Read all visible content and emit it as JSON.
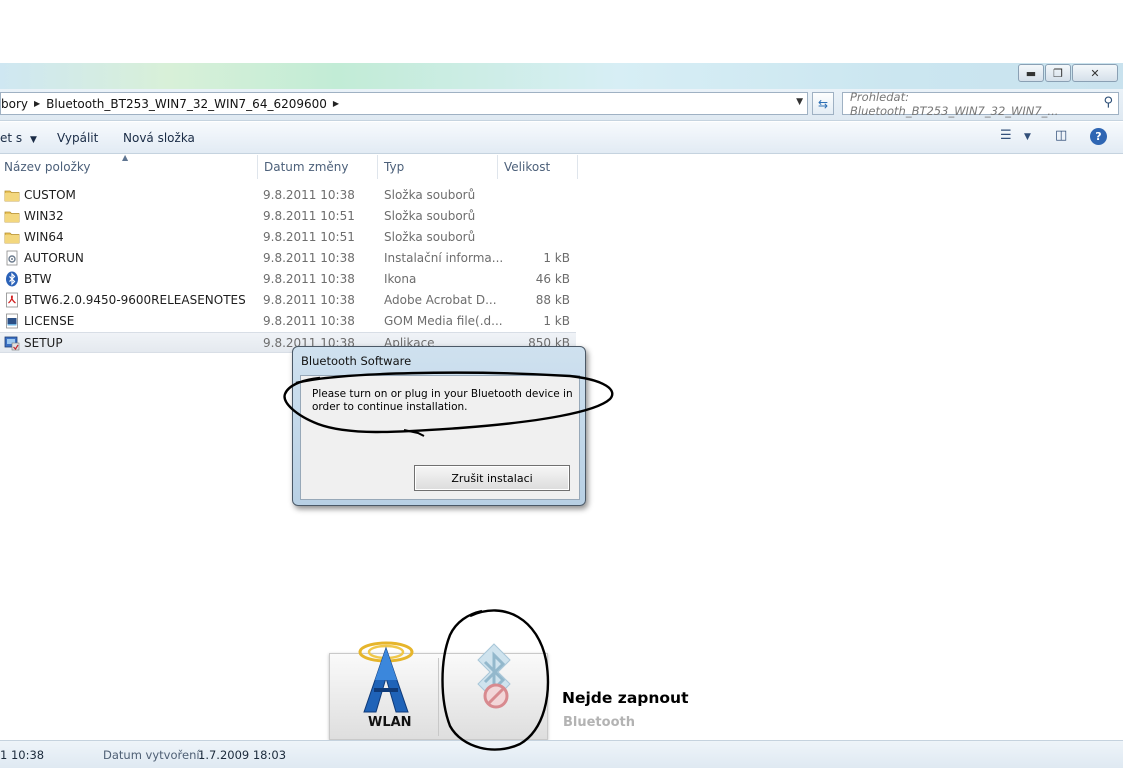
{
  "address": {
    "crumbs": [
      "bory",
      "Bluetooth_BT253_WIN7_32_WIN7_64_6209600"
    ],
    "search_placeholder": "Prohledat: Bluetooth_BT253_WIN7_32_WIN7_..."
  },
  "toolbar": {
    "organize": "et s",
    "burn": "Vypálit",
    "new_folder": "Nová složka"
  },
  "columns": {
    "name": "Název položky",
    "date": "Datum změny",
    "type": "Typ",
    "size": "Velikost"
  },
  "files": [
    {
      "name": "CUSTOM",
      "date": "9.8.2011 10:38",
      "type": "Složka souborů",
      "size": "",
      "icon": "folder-icon"
    },
    {
      "name": "WIN32",
      "date": "9.8.2011 10:51",
      "type": "Složka souborů",
      "size": "",
      "icon": "folder-icon"
    },
    {
      "name": "WIN64",
      "date": "9.8.2011 10:51",
      "type": "Složka souborů",
      "size": "",
      "icon": "folder-icon"
    },
    {
      "name": "AUTORUN",
      "date": "9.8.2011 10:38",
      "type": "Instalační informa...",
      "size": "1 kB",
      "icon": "setup-info-icon"
    },
    {
      "name": "BTW",
      "date": "9.8.2011 10:38",
      "type": "Ikona",
      "size": "46 kB",
      "icon": "bluetooth-icon"
    },
    {
      "name": "BTW6.2.0.9450-9600RELEASENOTES",
      "date": "9.8.2011 10:38",
      "type": "Adobe Acrobat D...",
      "size": "88 kB",
      "icon": "pdf-icon"
    },
    {
      "name": "LICENSE",
      "date": "9.8.2011 10:38",
      "type": "GOM Media file(.d...",
      "size": "1 kB",
      "icon": "media-file-icon"
    },
    {
      "name": "SETUP",
      "date": "9.8.2011 10:38",
      "type": "Aplikace",
      "size": "850 kB",
      "icon": "setup-app-icon"
    }
  ],
  "dialog": {
    "title": "Bluetooth Software",
    "message": "Please turn on or plug in your Bluetooth device in order to continue installation.",
    "cancel_button": "Zrušit instalaci"
  },
  "osd": {
    "wlan_label": "WLAN",
    "bluetooth_label": "Bluetooth"
  },
  "annotation": {
    "text": "Nejde zapnout"
  },
  "status": {
    "modified_fragment": "1 10:38",
    "created_label": "Datum vytvoření:",
    "created_value": "1.7.2009 18:03"
  }
}
